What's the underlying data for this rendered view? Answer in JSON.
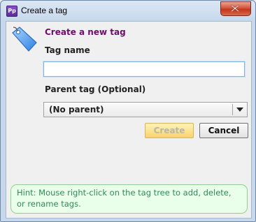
{
  "window": {
    "title": "Create a tag",
    "app_icon_label": "Pp"
  },
  "dialog": {
    "heading": "Create a new tag",
    "tag_name_label": "Tag name",
    "tag_name_value": "",
    "parent_label": "Parent tag (Optional)",
    "parent_selected": "(No parent)",
    "create_label": "Create",
    "cancel_label": "Cancel",
    "hint": "Hint: Mouse right-click on the tag tree to add, delete, or rename tags."
  },
  "icons": {
    "tag": "tag-icon",
    "close": "close-icon",
    "dropdown": "chevron-down-icon"
  },
  "colors": {
    "heading": "#6b0f6b",
    "hint_text": "#2e8b57",
    "hint_bg": "#eaffea",
    "close_button": "#c1371c"
  }
}
